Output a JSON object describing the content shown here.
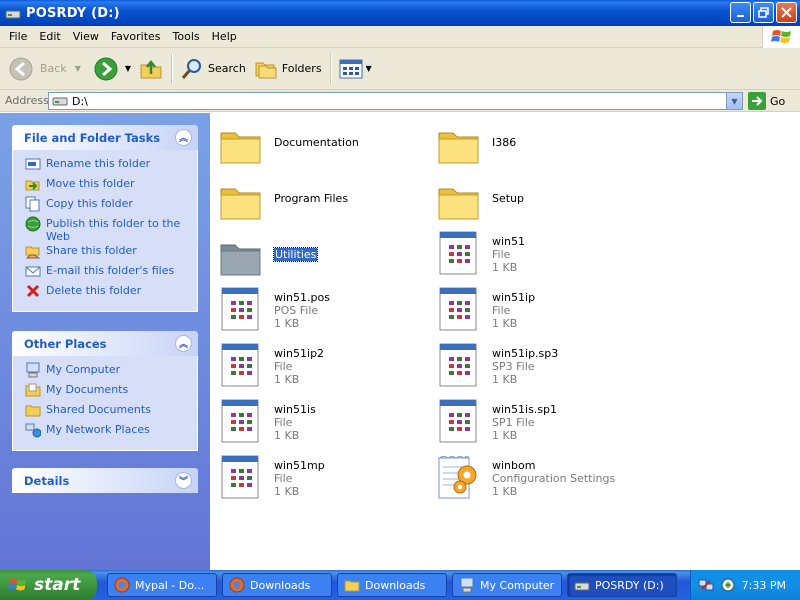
{
  "window": {
    "title": "POSRDY (D:)"
  },
  "menu": [
    "File",
    "Edit",
    "View",
    "Favorites",
    "Tools",
    "Help"
  ],
  "toolbar": {
    "back": "Back",
    "search": "Search",
    "folders": "Folders"
  },
  "address": {
    "label": "Address",
    "value": "D:\\",
    "go": "Go"
  },
  "file_tasks": {
    "title": "File and Folder Tasks",
    "items": [
      "Rename this folder",
      "Move this folder",
      "Copy this folder",
      "Publish this folder to the Web",
      "Share this folder",
      "E-mail this folder's files",
      "Delete this folder"
    ]
  },
  "other_places": {
    "title": "Other Places",
    "items": [
      "My Computer",
      "My Documents",
      "Shared Documents",
      "My Network Places"
    ]
  },
  "details": {
    "title": "Details"
  },
  "files": [
    {
      "name": "Documentation",
      "kind": "folder"
    },
    {
      "name": "I386",
      "kind": "folder"
    },
    {
      "name": "Program Files",
      "kind": "folder"
    },
    {
      "name": "Setup",
      "kind": "folder"
    },
    {
      "name": "Utilities",
      "kind": "folder-gray",
      "selected": true
    },
    {
      "name": "win51",
      "type": "File",
      "size": "1 KB",
      "kind": "file"
    },
    {
      "name": "win51.pos",
      "type": "POS File",
      "size": "1 KB",
      "kind": "file"
    },
    {
      "name": "win51ip",
      "type": "File",
      "size": "1 KB",
      "kind": "file"
    },
    {
      "name": "win51ip2",
      "type": "File",
      "size": "1 KB",
      "kind": "file"
    },
    {
      "name": "win51ip.sp3",
      "type": "SP3 File",
      "size": "1 KB",
      "kind": "file"
    },
    {
      "name": "win51is",
      "type": "File",
      "size": "1 KB",
      "kind": "file"
    },
    {
      "name": "win51is.sp1",
      "type": "SP1 File",
      "size": "1 KB",
      "kind": "file"
    },
    {
      "name": "win51mp",
      "type": "File",
      "size": "1 KB",
      "kind": "file"
    },
    {
      "name": "winbom",
      "type": "Configuration Settings",
      "size": "1 KB",
      "kind": "config"
    }
  ],
  "taskbar": {
    "start": "start",
    "tasks": [
      "Mypal - Do...",
      "Downloads",
      "Downloads",
      "My Computer",
      "POSRDY (D:)"
    ],
    "clock": "7:33 PM"
  },
  "colors": {
    "title_bar": "#0a53d0",
    "task_pane": "#6375d6",
    "selection": "#316ac5",
    "taskbar": "#2157d7",
    "start_button": "#3b923b"
  }
}
